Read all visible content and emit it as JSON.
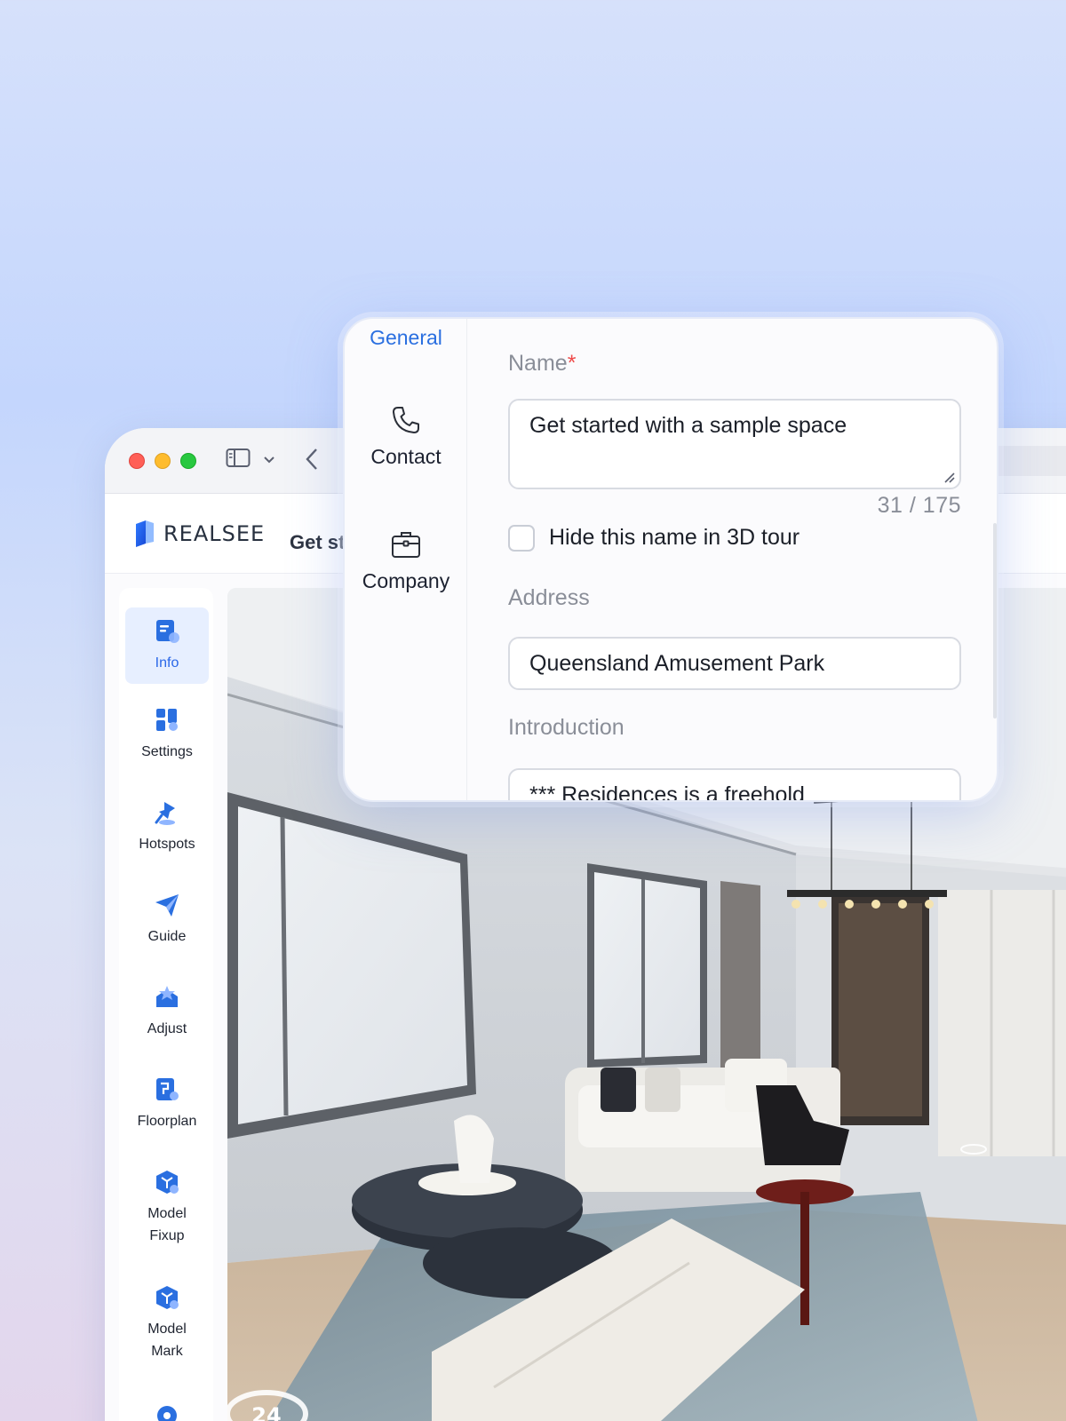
{
  "app": {
    "brand": "REALSEE",
    "page_title": "Get st"
  },
  "sidebar": {
    "items": [
      {
        "label": "Info",
        "icon": "info-doc-icon",
        "active": true
      },
      {
        "label": "Settings",
        "icon": "settings-blocks-icon"
      },
      {
        "label": "Hotspots",
        "icon": "pin-icon"
      },
      {
        "label": "Guide",
        "icon": "paper-plane-icon"
      },
      {
        "label": "Adjust",
        "icon": "adjust-tray-icon"
      },
      {
        "label": "Floorplan",
        "icon": "floorplan-icon"
      },
      {
        "label": "Model\nFixup",
        "icon": "model-cube-icon"
      },
      {
        "label": "Model\nMark",
        "icon": "model-cube-icon"
      }
    ]
  },
  "viewport": {
    "hotspot_number": "24"
  },
  "panel": {
    "nav": {
      "general": "General",
      "contact": "Contact",
      "company": "Company"
    },
    "form": {
      "name_label": "Name",
      "required_mark": "*",
      "name_value": "Get started with a sample space",
      "name_counter": "31 / 175",
      "hide_name_label": "Hide this name in 3D tour",
      "hide_name_checked": false,
      "address_label": "Address",
      "address_value": "Queensland Amusement Park",
      "introduction_label": "Introduction",
      "introduction_value": "*** Residences is a freehold"
    }
  },
  "colors": {
    "accent": "#2a6fe0",
    "required": "#ef4b4b",
    "active_bg": "#e7efff"
  }
}
